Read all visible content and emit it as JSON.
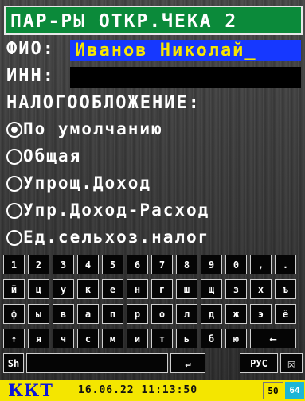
{
  "header": {
    "title": "ПАР-РЫ ОТКР.ЧЕКА 2"
  },
  "fio": {
    "label": "ФИО:",
    "value": "Иванов Николай_"
  },
  "inn": {
    "label": "ИНН:",
    "value": ""
  },
  "taxation": {
    "label": "НАЛОГООБЛОЖЕНИЕ:",
    "options": [
      {
        "label": "По умолчанию",
        "selected": true
      },
      {
        "label": "Общая",
        "selected": false
      },
      {
        "label": "Упрощ.Доход",
        "selected": false
      },
      {
        "label": "Упр.Доход-Расход",
        "selected": false
      },
      {
        "label": "Ед.сельхоз.налог",
        "selected": false
      }
    ]
  },
  "keyboard": {
    "row1": [
      "1",
      "2",
      "3",
      "4",
      "5",
      "6",
      "7",
      "8",
      "9",
      "0",
      ",",
      "."
    ],
    "row2": [
      "й",
      "ц",
      "у",
      "к",
      "е",
      "н",
      "г",
      "ш",
      "щ",
      "з",
      "х",
      "ъ"
    ],
    "row3": [
      "ф",
      "ы",
      "в",
      "а",
      "п",
      "р",
      "о",
      "л",
      "д",
      "ж",
      "э",
      "ё"
    ],
    "row4": [
      "↑",
      "я",
      "ч",
      "с",
      "м",
      "и",
      "т",
      "ь",
      "б",
      "ю",
      "⟵"
    ],
    "row5": {
      "shift": "Sh",
      "enter": "↵",
      "lang": "РУС",
      "close": "☒"
    }
  },
  "footer": {
    "brand": "ККТ",
    "datetime": "16.06.22 11:13:50",
    "badge1": "50",
    "badge2": "64"
  }
}
